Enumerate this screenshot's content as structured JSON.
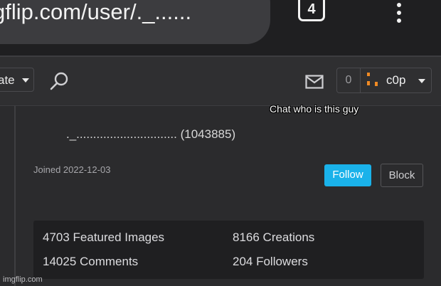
{
  "browser": {
    "url": "gflip.com/user/._......",
    "tab_count": "4",
    "menu_icon": "kebab-menu-icon"
  },
  "header": {
    "create_label": "ate",
    "search_icon": "search-icon",
    "mail_icon": "mail-icon",
    "notification_count": "0",
    "username": "c0p",
    "avatar_color": "#f08a24"
  },
  "overlay": {
    "caption": "Chat who is this guy"
  },
  "profile": {
    "display": "._.............................. (1043885)",
    "joined": "Joined 2022-12-03",
    "follow_label": "Follow",
    "block_label": "Block",
    "follow_color": "#1ab2ea"
  },
  "stats": {
    "featured": "4703 Featured Images",
    "creations": "8166 Creations",
    "comments": "14025 Comments",
    "followers": "204 Followers"
  },
  "watermark": "imgflip.com"
}
